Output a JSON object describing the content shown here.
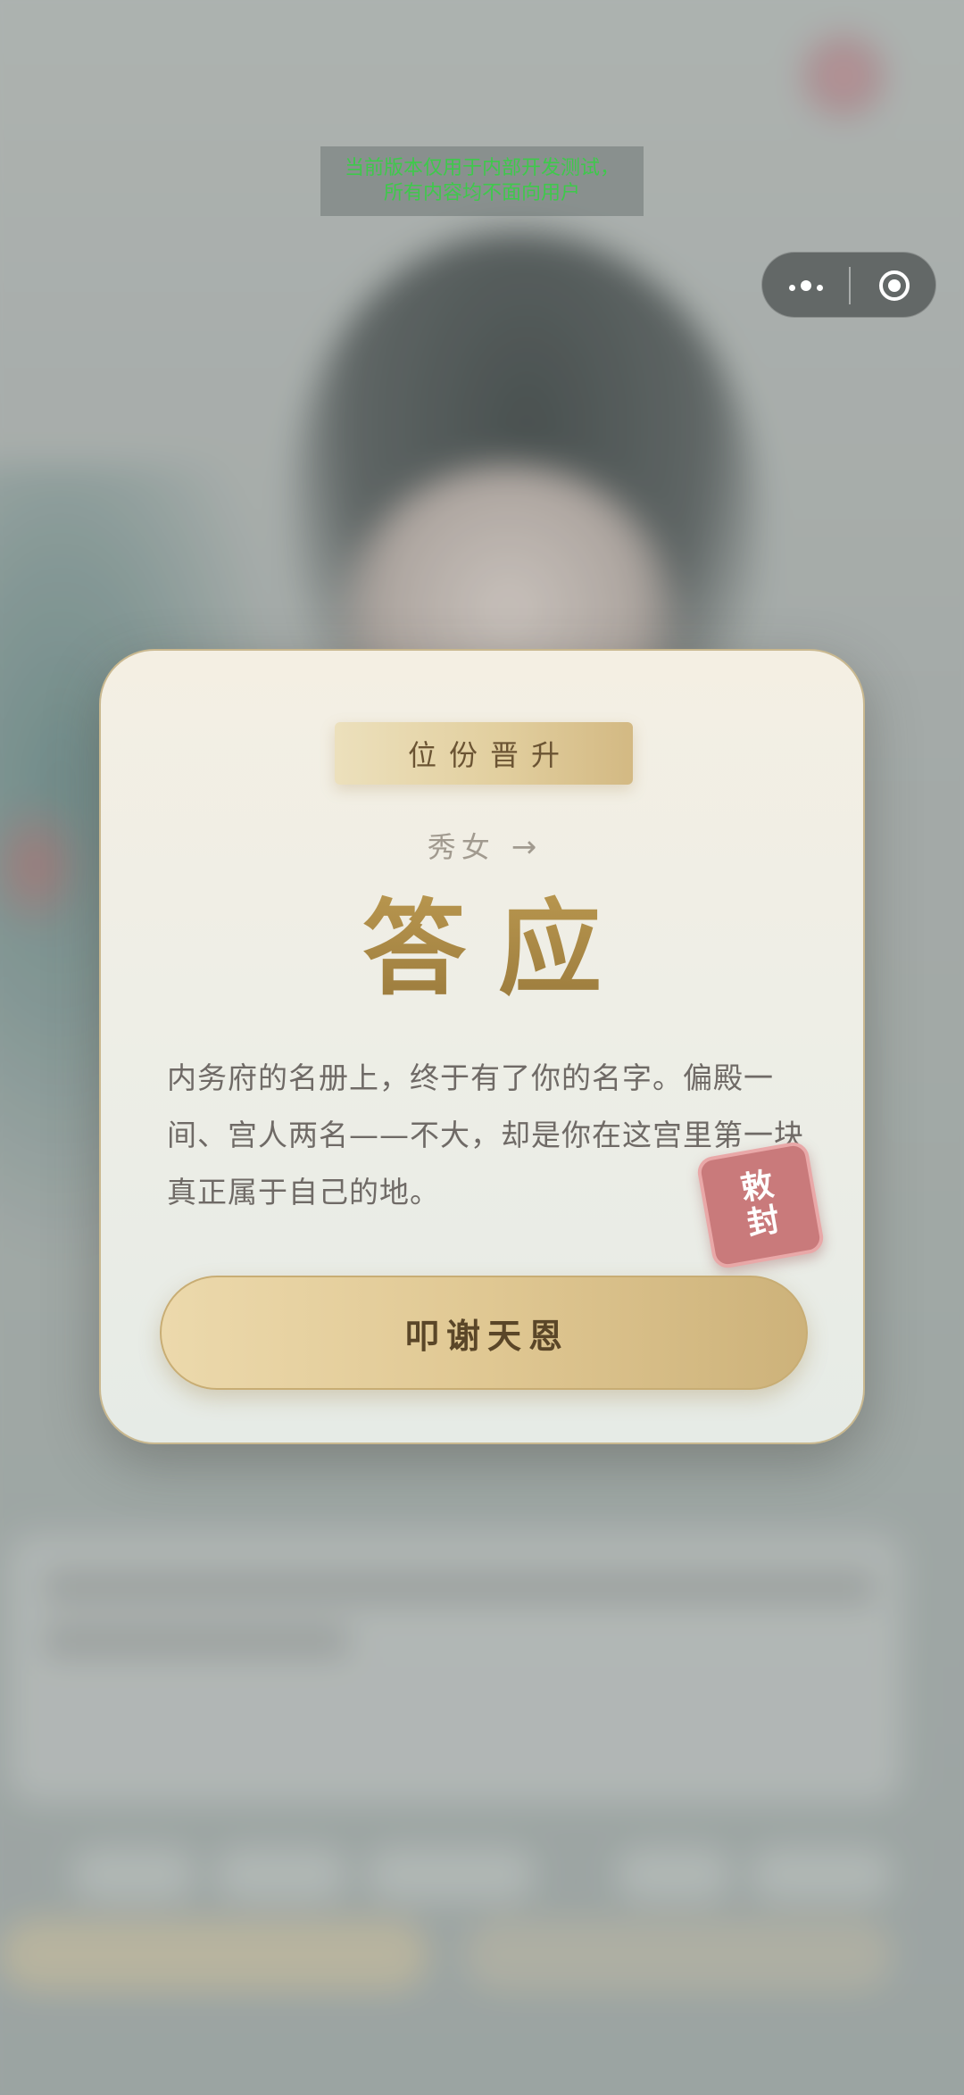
{
  "dev_banner": {
    "line1": "当前版本仅用于内部开发测试，",
    "line2": "所有内容均不面向用户"
  },
  "capsule": {
    "more_icon": "more-dots-icon",
    "close_icon": "target-close-icon"
  },
  "modal": {
    "badge": "位份晋升",
    "from_rank": "秀女",
    "arrow": "→",
    "new_rank": "答应",
    "description": "内务府的名册上，终于有了你的名字。偏殿一间、宫人两名——不大，却是你在这宫里第一块真正属于自己的地。",
    "seal": {
      "line1": "敕",
      "line2": "封"
    },
    "confirm_button": "叩谢天恩"
  },
  "colors": {
    "banner_text": "#3ec94b",
    "gold_text": "#a78847",
    "seal_red": "#c97a7b",
    "button_gold": "#e0c893"
  }
}
